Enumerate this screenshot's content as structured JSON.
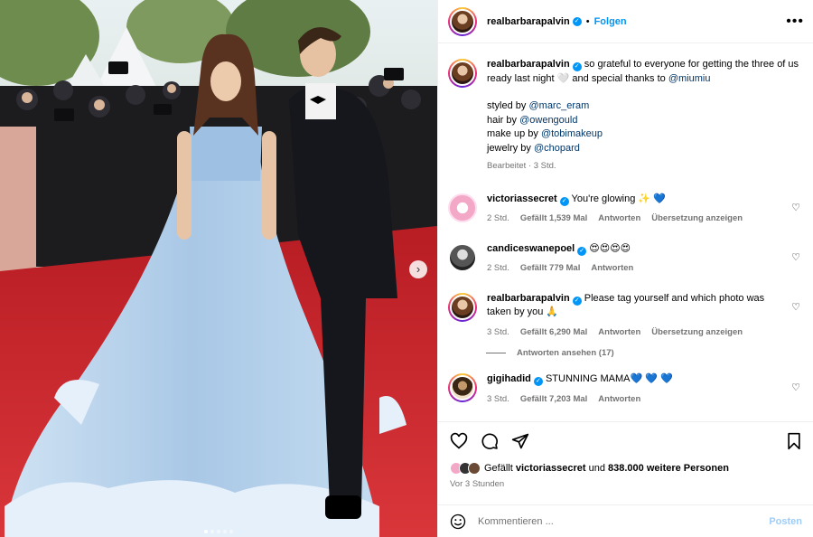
{
  "post": {
    "author": "realbarbarapalvin",
    "follow_label": "Folgen",
    "more_icon": "more-options-icon",
    "caption_lines_1": "so grateful to everyone for getting the three of us ready last night 🤍 and special thanks to",
    "caption_mention_1": "@miumiu",
    "styled_label": "styled by",
    "styled_mention": "@marc_eram",
    "hair_label": "hair by",
    "hair_mention": "@owengould",
    "makeup_label": "make up by",
    "makeup_mention": "@tobimakeup",
    "jewelry_label": "jewelry by",
    "jewelry_mention": "@chopard",
    "caption_meta": "Bearbeitet · 3 Std."
  },
  "comments": [
    {
      "user": "victoriassecret",
      "text": "You're glowing ✨ 💙",
      "time": "2 Std.",
      "likes": "Gefällt 1,539 Mal",
      "reply": "Antworten",
      "translate": "Übersetzung anzeigen"
    },
    {
      "user": "candiceswanepoel",
      "text": "😍😍😍😍",
      "time": "2 Std.",
      "likes": "Gefällt 779 Mal",
      "reply": "Antworten"
    },
    {
      "user": "realbarbarapalvin",
      "text": "Please tag yourself and which photo was taken by you 🙏",
      "time": "3 Std.",
      "likes": "Gefällt 6,290 Mal",
      "reply": "Antworten",
      "translate": "Übersetzung anzeigen",
      "view_replies": "Antworten ansehen (17)"
    },
    {
      "user": "gigihadid",
      "text": "STUNNING MAMA💙 💙 💙",
      "time": "3 Std.",
      "likes": "Gefällt 7,203 Mal",
      "reply": "Antworten"
    }
  ],
  "actions": {
    "liked_by_prefix": "Gefällt",
    "liked_by_user": "victoriassecret",
    "liked_by_rest_mid": "und",
    "liked_by_count": "838.000 weitere Personen",
    "ago": "Vor 3 Stunden"
  },
  "composer": {
    "placeholder": "Kommentieren ...",
    "post_label": "Posten"
  },
  "carousel": {
    "next_icon": "chevron-right-icon",
    "slide_count": 5,
    "active_index": 0
  },
  "colors": {
    "accent": "#0095f6",
    "mention": "#00376b",
    "muted": "#737373",
    "carpet": "#c8202a",
    "dress": "#bcd6ee"
  }
}
